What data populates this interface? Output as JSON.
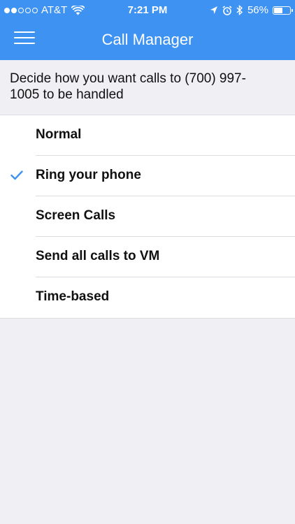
{
  "status_bar": {
    "carrier": "AT&T",
    "time": "7:21 PM",
    "battery_percent": "56%",
    "battery_level": 0.56,
    "signal_bars_filled": 2,
    "signal_bars_total": 5,
    "icons": [
      "wifi-icon",
      "location-arrow-icon",
      "alarm-icon",
      "bluetooth-icon",
      "battery-icon"
    ]
  },
  "nav": {
    "title": "Call Manager",
    "menu_icon": "hamburger-menu-icon"
  },
  "description": "Decide how you want calls to (700) 997-1005 to be handled",
  "options": [
    {
      "label": "Normal",
      "selected": false
    },
    {
      "label": "Ring your phone",
      "selected": true
    },
    {
      "label": "Screen Calls",
      "selected": false
    },
    {
      "label": "Send all calls to VM",
      "selected": false
    },
    {
      "label": "Time-based",
      "selected": false
    }
  ],
  "colors": {
    "header": "#3d92f2",
    "background": "#efeff4",
    "checkmark": "#3d92f2"
  }
}
